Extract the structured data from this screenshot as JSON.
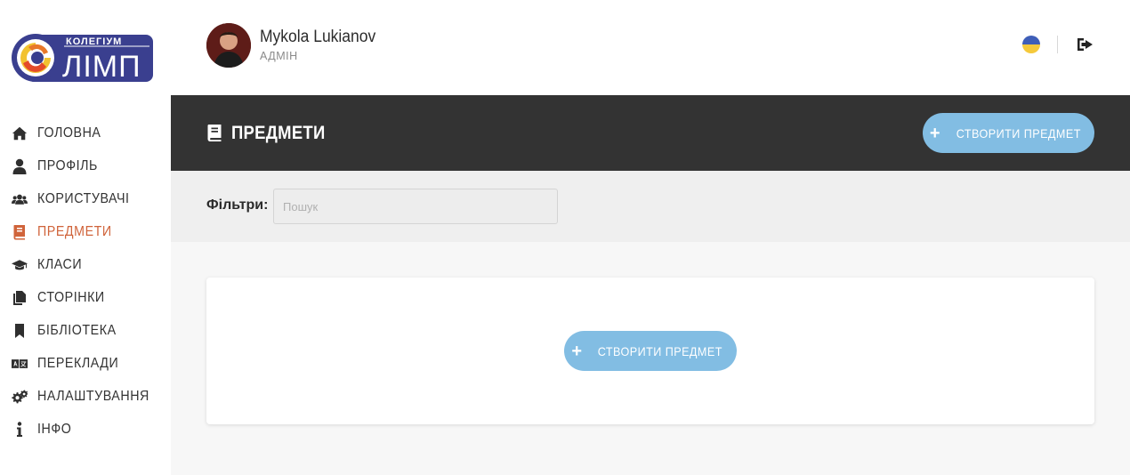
{
  "logo": {
    "top_text": "КОЛЕГІУМ",
    "main_text": "ЛІМП"
  },
  "sidebar": {
    "items": [
      {
        "label": "ГОЛОВНА",
        "icon": "home-icon",
        "active": false
      },
      {
        "label": "ПРОФІЛЬ",
        "icon": "user-icon",
        "active": false
      },
      {
        "label": "КОРИСТУВАЧІ",
        "icon": "users-icon",
        "active": false
      },
      {
        "label": "ПРЕДМЕТИ",
        "icon": "book-icon",
        "active": true
      },
      {
        "label": "КЛАСИ",
        "icon": "graduation-cap-icon",
        "active": false
      },
      {
        "label": "СТОРІНКИ",
        "icon": "copy-icon",
        "active": false
      },
      {
        "label": "БІБЛІОТЕКА",
        "icon": "bookmark-icon",
        "active": false
      },
      {
        "label": "ПЕРЕКЛАДИ",
        "icon": "language-icon",
        "active": false
      },
      {
        "label": "НАЛАШТУВАННЯ",
        "icon": "cogs-icon",
        "active": false
      },
      {
        "label": "ІНФО",
        "icon": "info-icon",
        "active": false
      }
    ]
  },
  "header": {
    "user_name": "Mykola Lukianov",
    "user_role": "АДМІН"
  },
  "page": {
    "title": "ПРЕДМЕТИ",
    "create_button_label": "СТВОРИТИ ПРЕДМЕТ"
  },
  "filters": {
    "label": "Фільтри:",
    "search_placeholder": "Пошук",
    "search_value": ""
  },
  "empty_state": {
    "create_button_label": "СТВОРИТИ ПРЕДМЕТ"
  },
  "colors": {
    "accent_active": "#d0643b",
    "primary_button": "#82bde3",
    "titlebar_bg": "#333333",
    "flag_blue": "#3e5eb8",
    "flag_yellow": "#f5c93b"
  }
}
